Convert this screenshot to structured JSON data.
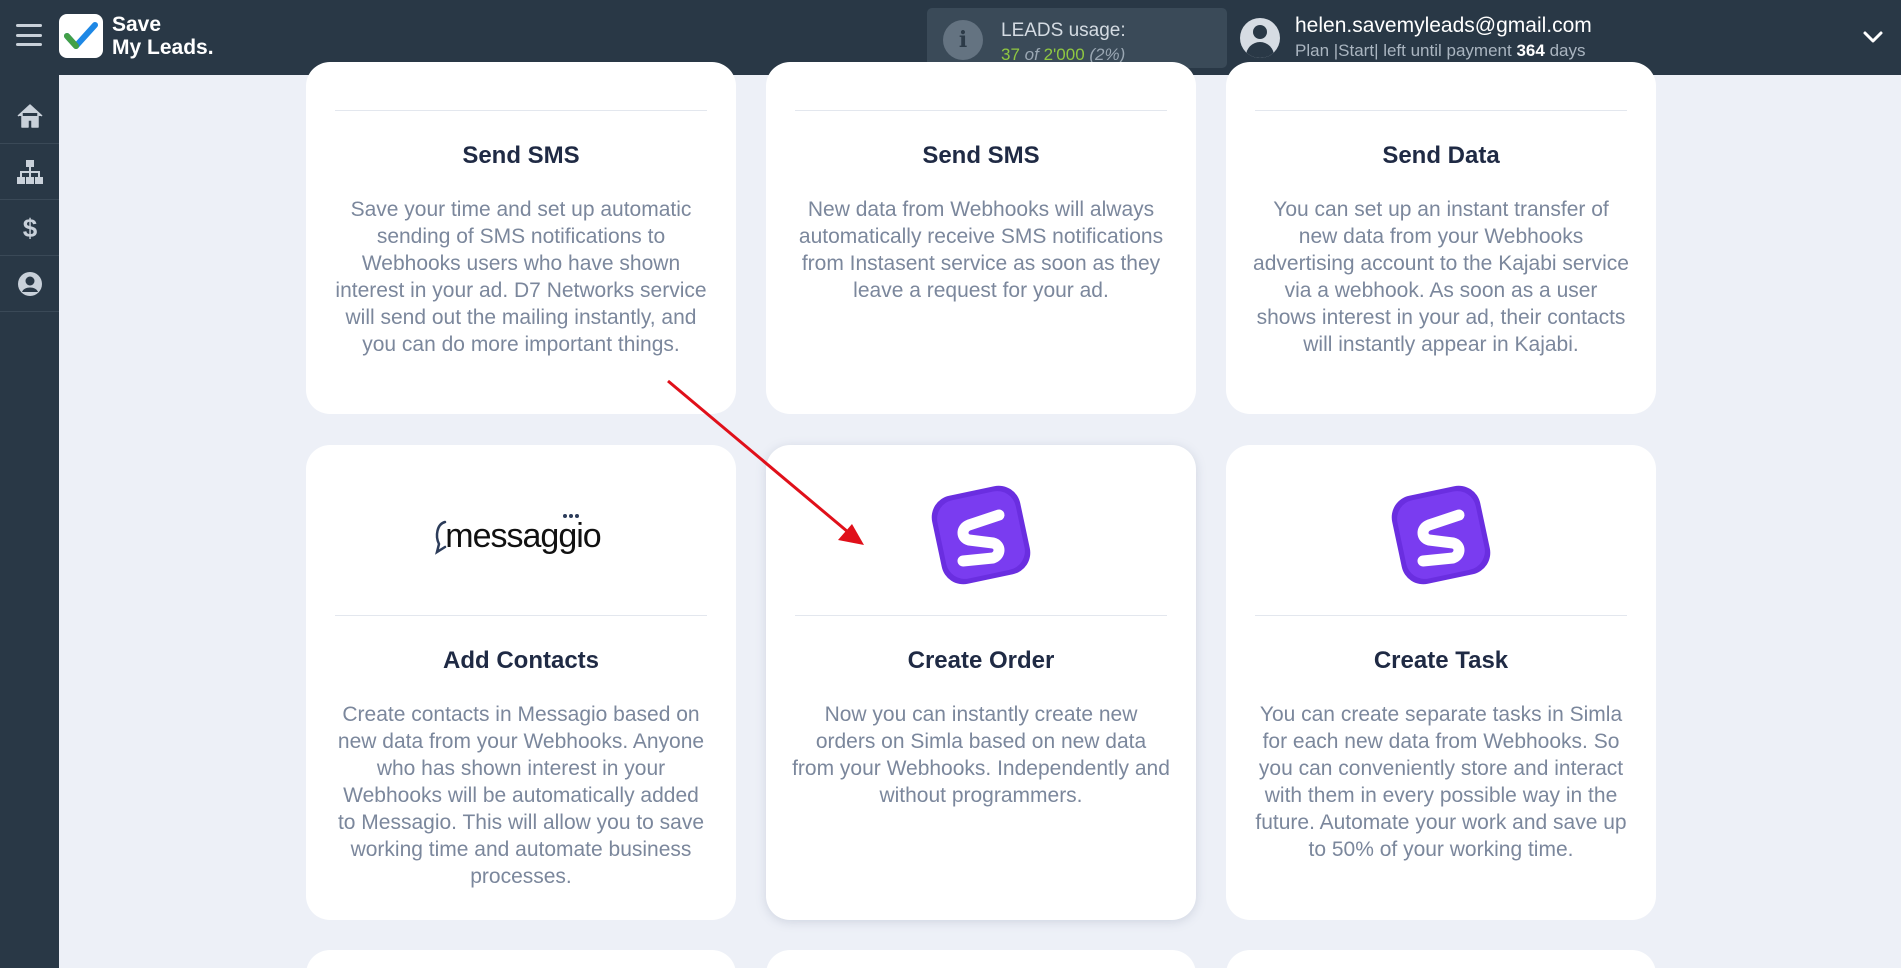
{
  "brand": {
    "line1": "Save",
    "line2": "My Leads."
  },
  "usage": {
    "label": "LEADS usage:",
    "used": "37",
    "of": "of",
    "total": "2'000",
    "percent": "(2%)"
  },
  "account": {
    "email": "helen.savemyleads@gmail.com",
    "plan_prefix": "Plan |Start| left until payment",
    "days": "364",
    "days_suffix": "days"
  },
  "sidebar": {
    "items": [
      {
        "icon": "home-icon"
      },
      {
        "icon": "sitemap-icon"
      },
      {
        "icon": "dollar-icon"
      },
      {
        "icon": "user-circle-icon"
      }
    ]
  },
  "cards": [
    {
      "title": "Send SMS",
      "desc": "Save your time and set up automatic sending of SMS notifications to Webhooks users who have shown interest in your ad. D7 Networks service will send out the mailing instantly, and you can do more important things."
    },
    {
      "title": "Send SMS",
      "desc": "New data from Webhooks will always automatically receive SMS notifications from Instasent service as soon as they leave a request for your ad."
    },
    {
      "title": "Send Data",
      "desc": "You can set up an instant transfer of new data from your Webhooks advertising account to the Kajabi service via a webhook. As soon as a user shows interest in your ad, their contacts will instantly appear in Kajabi."
    },
    {
      "logo": "messaggio",
      "title": "Add Contacts",
      "desc": "Create contacts in Messagio based on new data from your Webhooks. Anyone who has shown interest in your Webhooks will be automatically added to Messagio. This will allow you to save working time and automate business processes."
    },
    {
      "logo": "simla-icon",
      "title": "Create Order",
      "desc": "Now you can instantly create new orders on Simla based on new data from your Webhooks. Independently and without programmers."
    },
    {
      "logo": "simla-icon",
      "title": "Create Task",
      "desc": "You can create separate tasks in Simla for each new data from Webhooks. So you can conveniently store and interact with them in every possible way in the future. Automate your work and save up to 50% of your working time."
    }
  ],
  "colors": {
    "topbar": "#293846",
    "accent_green": "#8fc741",
    "simla_purple": "#6a2ee0",
    "arrow_red": "#e0101a"
  }
}
